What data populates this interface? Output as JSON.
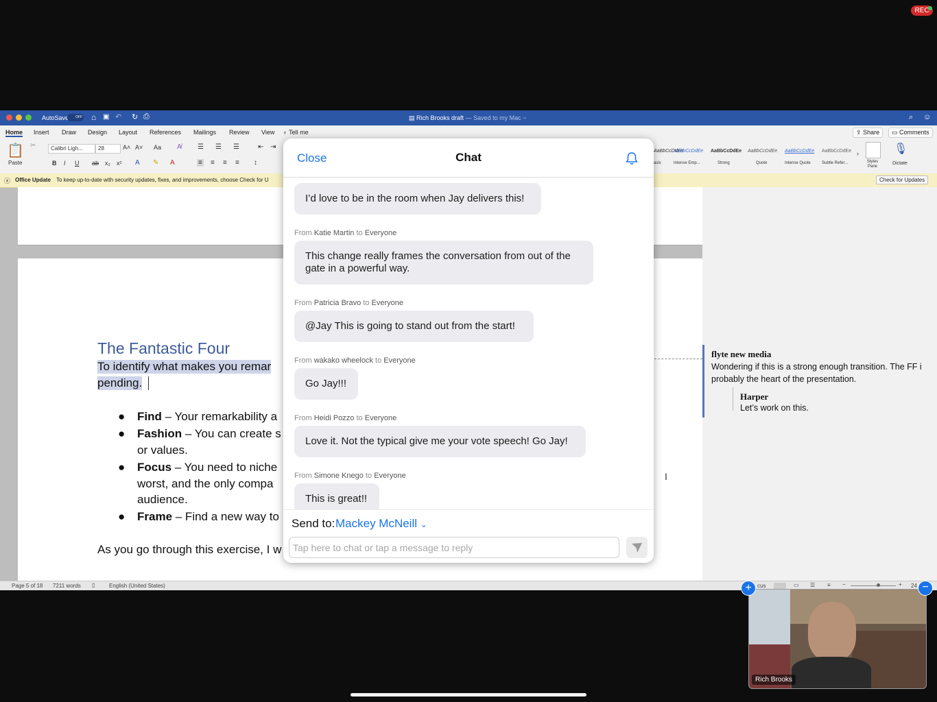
{
  "recording": {
    "label": "REC"
  },
  "word": {
    "autosave_label": "AutoSave",
    "autosave_state": "OFF",
    "doc_title": "Rich Brooks draft",
    "doc_status": "— Saved to my Mac ~",
    "tabs": [
      "Home",
      "Insert",
      "Draw",
      "Design",
      "Layout",
      "References",
      "Mailings",
      "Review",
      "View"
    ],
    "tell_me": "Tell me",
    "share": "Share",
    "comments": "Comments",
    "paste": "Paste",
    "font_name": "Calibri Ligh...",
    "font_size": "28",
    "styles": [
      "AaBbCcDdEe",
      "AaBbCcDdEe",
      "AaBbCcDdEe",
      "AaBbCcDdEe",
      "AaBbCcDdEe",
      "AaBbCcDdEe"
    ],
    "style_names": [
      "asis",
      "Intense Emp...",
      "Strong",
      "Quote",
      "Intense Quote",
      "Subtle Refer..."
    ],
    "styles_pane": "Styles Pane",
    "dictate": "Dictate",
    "update_title": "Office Update",
    "update_text": "To keep up-to-date with security updates, fixes, and improvements, choose Check for U",
    "check_updates": "Check for Updates",
    "doc_heading": "The Fantastic Four",
    "doc_para1a": "To identify what makes you remar",
    "doc_para1b": "pending.",
    "bullets": [
      {
        "bold": "Find",
        "text": " – Your remarkability a"
      },
      {
        "bold": "Fashion",
        "text": " – You can create s"
      },
      {
        "bold": "",
        "text": "or values."
      },
      {
        "bold": "Focus",
        "text": " – You need to niche"
      },
      {
        "bold": "",
        "text": "worst, and the only compa"
      },
      {
        "bold": "",
        "text": "audience."
      },
      {
        "bold": "Frame",
        "text": " – Find a new way to"
      }
    ],
    "doc_para2": "As you go through this exercise, I w",
    "comment1_author": "flyte new media",
    "comment1_text": "Wondering if this is a strong enough transition. The FF i probably the heart of the presentation.",
    "comment2_author": "Harper",
    "comment2_text": "Let’s work on this.",
    "status_page": "Page 5 of 18",
    "status_words": "7211 words",
    "status_lang": "English (United States)",
    "status_focus": "cus",
    "status_zoom": "24"
  },
  "chat": {
    "close": "Close",
    "title": "Chat",
    "messages": [
      {
        "from": "",
        "to": "",
        "text": "I’d love to be in the room when Jay delivers this!"
      },
      {
        "from": "Katie Martin",
        "to": "Everyone",
        "text": "This change really frames the conversation from out of the gate in a powerful way."
      },
      {
        "from": "Patricia Bravo",
        "to": "Everyone",
        "text": "@Jay This is going to stand out from the start!"
      },
      {
        "from": "wakako wheelock",
        "to": "Everyone",
        "text": "Go Jay!!!"
      },
      {
        "from": "Heidi Pozzo",
        "to": "Everyone",
        "text": "Love it. Not the typical give me your vote speech! Go Jay!"
      },
      {
        "from": "Simone Knego",
        "to": "Everyone",
        "text": "This is great!!"
      }
    ],
    "from_word": "From",
    "to_word": "to",
    "send_to_label": "Send to:",
    "send_to_value": "Mackey McNeill",
    "input_placeholder": "Tap here to chat or tap a message to reply"
  },
  "video": {
    "name": "Rich Brooks"
  },
  "colors": {
    "accent": "#1a73e8",
    "word_blue": "#2c56a6",
    "heading": "#3b5b9a"
  }
}
